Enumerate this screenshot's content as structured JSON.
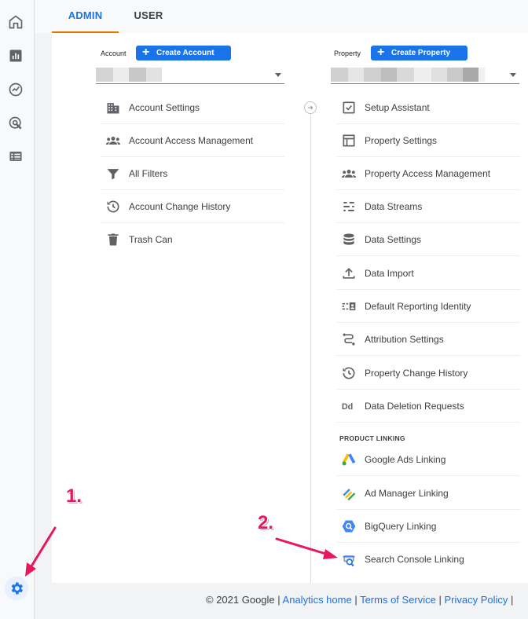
{
  "tabs": {
    "admin": "ADMIN",
    "user": "USER"
  },
  "account": {
    "label": "Account",
    "create_button": "Create Account",
    "menu": [
      {
        "label": "Account Settings",
        "icon": "building-icon"
      },
      {
        "label": "Account Access Management",
        "icon": "people-icon"
      },
      {
        "label": "All Filters",
        "icon": "filter-icon"
      },
      {
        "label": "Account Change History",
        "icon": "history-icon"
      },
      {
        "label": "Trash Can",
        "icon": "trash-icon"
      }
    ]
  },
  "property": {
    "label": "Property",
    "create_button": "Create Property",
    "menu": [
      {
        "label": "Setup Assistant",
        "icon": "checkbox-icon"
      },
      {
        "label": "Property Settings",
        "icon": "window-icon"
      },
      {
        "label": "Property Access Management",
        "icon": "people-icon"
      },
      {
        "label": "Data Streams",
        "icon": "streams-icon"
      },
      {
        "label": "Data Settings",
        "icon": "database-icon"
      },
      {
        "label": "Data Import",
        "icon": "upload-icon"
      },
      {
        "label": "Default Reporting Identity",
        "icon": "identity-icon"
      },
      {
        "label": "Attribution Settings",
        "icon": "attribution-icon"
      },
      {
        "label": "Property Change History",
        "icon": "history-icon"
      },
      {
        "label": "Data Deletion Requests",
        "icon": "dd-icon"
      }
    ],
    "product_linking_heading": "PRODUCT LINKING",
    "linking": [
      {
        "label": "Google Ads Linking",
        "icon": "google-ads-icon"
      },
      {
        "label": "Ad Manager Linking",
        "icon": "ad-manager-icon"
      },
      {
        "label": "BigQuery Linking",
        "icon": "bigquery-icon"
      },
      {
        "label": "Search Console Linking",
        "icon": "search-console-icon"
      }
    ]
  },
  "annotations": {
    "step1": "1.",
    "step2": "2."
  },
  "footer": {
    "copyright": "© 2021 Google",
    "sep": " | ",
    "links": [
      "Analytics home",
      "Terms of Service",
      "Privacy Policy"
    ],
    "trail": " |"
  },
  "colors": {
    "accent": "#1a73e8",
    "tab_underline": "#e37400",
    "annotation": "#e8175d"
  }
}
